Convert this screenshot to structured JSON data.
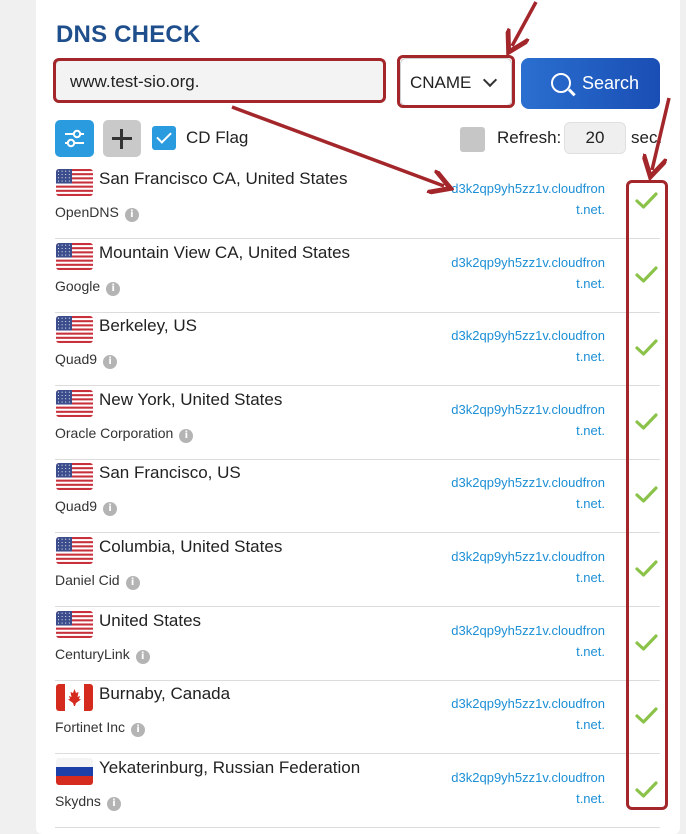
{
  "title": "DNS CHECK",
  "search": {
    "value": "www.test-sio.org.",
    "record_type": "CNAME",
    "button_label": "Search"
  },
  "toolbar": {
    "cd_flag_label": "CD Flag",
    "cd_flag_checked": true,
    "refresh_label": "Refresh:",
    "refresh_value": "20",
    "refresh_unit": "sec.",
    "refresh_checked": false
  },
  "results": [
    {
      "flag": "us",
      "location": "San Francisco CA, United States",
      "provider": "OpenDNS",
      "answer": "d3k2qp9yh5zz1v.cloudfront.net.",
      "status": "ok"
    },
    {
      "flag": "us",
      "location": "Mountain View CA, United States",
      "provider": "Google",
      "answer": "d3k2qp9yh5zz1v.cloudfront.net.",
      "status": "ok"
    },
    {
      "flag": "us",
      "location": "Berkeley, US",
      "provider": "Quad9",
      "answer": "d3k2qp9yh5zz1v.cloudfront.net.",
      "status": "ok"
    },
    {
      "flag": "us",
      "location": "New York, United States",
      "provider": "Oracle Corporation",
      "answer": "d3k2qp9yh5zz1v.cloudfront.net.",
      "status": "ok"
    },
    {
      "flag": "us",
      "location": "San Francisco, US",
      "provider": "Quad9",
      "answer": "d3k2qp9yh5zz1v.cloudfront.net.",
      "status": "ok"
    },
    {
      "flag": "us",
      "location": "Columbia, United States",
      "provider": "Daniel Cid",
      "answer": "d3k2qp9yh5zz1v.cloudfront.net.",
      "status": "ok"
    },
    {
      "flag": "us",
      "location": "United States",
      "provider": "CenturyLink",
      "answer": "d3k2qp9yh5zz1v.cloudfront.net.",
      "status": "ok"
    },
    {
      "flag": "ca",
      "location": "Burnaby, Canada",
      "provider": "Fortinet Inc",
      "answer": "d3k2qp9yh5zz1v.cloudfront.net.",
      "status": "ok"
    },
    {
      "flag": "ru",
      "location": "Yekaterinburg, Russian Federation",
      "provider": "Skydns",
      "answer": "d3k2qp9yh5zz1v.cloudfront.net.",
      "status": "ok"
    }
  ],
  "colors": {
    "title": "#1e4f8c",
    "accent": "#2a9bdf",
    "answer_link": "#1c8fd5",
    "check_ok": "#8bc34a",
    "annotation": "#a3262b"
  },
  "icons": {
    "info": "info-icon",
    "search": "search-icon",
    "settings": "sliders-icon",
    "add": "plus-icon",
    "status_ok": "checkmark-icon"
  }
}
